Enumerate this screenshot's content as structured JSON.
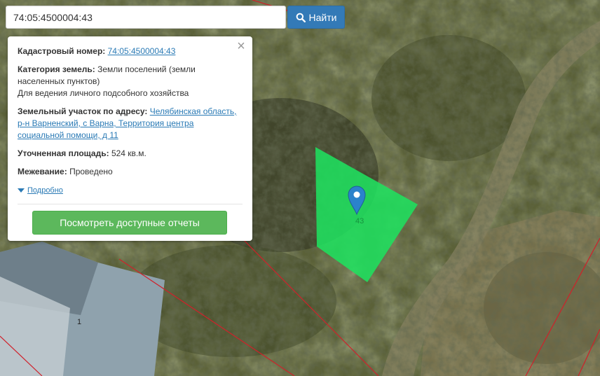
{
  "search": {
    "value": "74:05:4500004:43",
    "button_label": "Найти"
  },
  "popup": {
    "cadastral_label": "Кадастровый номер:",
    "cadastral_value": "74:05:4500004:43",
    "category_label": "Категория земель:",
    "category_value": "Земли поселений (земли населенных пунктов)",
    "purpose": "Для ведения личного подсобного хозяйства",
    "address_label": "Земельный участок по адресу:",
    "address_value": "Челябинская область, р-н Варненский, с Варна, Территория центра социальной помощи, д 11",
    "area_label": "Уточненная площадь:",
    "area_value": "524 кв.м.",
    "survey_label": "Межевание:",
    "survey_value": "Проведено",
    "more_link": "Подробно",
    "report_button": "Посмотреть доступные отчеты",
    "close_symbol": "×"
  },
  "map": {
    "parcel_label": "43",
    "building_label": "1",
    "parcel_color": "#1fe05e",
    "boundary_color": "#d0202a",
    "marker_color": "#2b82cb"
  }
}
